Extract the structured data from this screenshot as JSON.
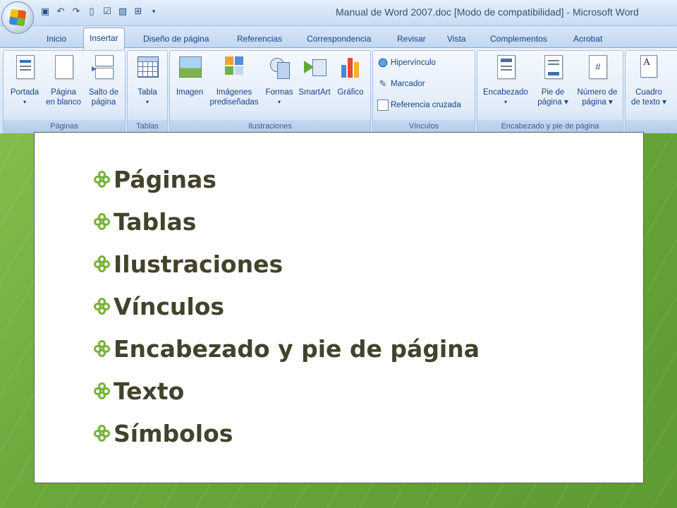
{
  "window": {
    "title": "Manual de Word 2007.doc [Modo de compatibilidad] - Microsoft Word"
  },
  "quick_access": [
    {
      "icon": "save-icon"
    },
    {
      "icon": "undo-icon"
    },
    {
      "icon": "redo-icon"
    },
    {
      "icon": "new-document-icon"
    },
    {
      "icon": "check-icon"
    },
    {
      "icon": "image-icon"
    },
    {
      "icon": "hierarchy-icon"
    },
    {
      "icon": "customize-arrow-icon"
    }
  ],
  "tabs": [
    {
      "label": "Inicio"
    },
    {
      "label": "Insertar",
      "active": true
    },
    {
      "label": "Diseño de página"
    },
    {
      "label": "Referencias"
    },
    {
      "label": "Correspondencia"
    },
    {
      "label": "Revisar"
    },
    {
      "label": "Vista"
    },
    {
      "label": "Complementos"
    },
    {
      "label": "Acrobat"
    }
  ],
  "ribbon": {
    "groups": [
      {
        "label": "Páginas",
        "buttons": [
          {
            "label1": "Portada",
            "label2": "▾"
          },
          {
            "label1": "Página",
            "label2": "en blanco"
          },
          {
            "label1": "Salto de",
            "label2": "página"
          }
        ]
      },
      {
        "label": "Tablas",
        "buttons": [
          {
            "label1": "Tabla",
            "label2": "▾"
          }
        ]
      },
      {
        "label": "Ilustraciones",
        "buttons": [
          {
            "label1": "Imagen",
            "label2": ""
          },
          {
            "label1": "Imágenes",
            "label2": "prediseñadas"
          },
          {
            "label1": "Formas",
            "label2": "▾"
          },
          {
            "label1": "SmartArt",
            "label2": ""
          },
          {
            "label1": "Gráfico",
            "label2": ""
          }
        ]
      },
      {
        "label": "Vínculos",
        "items": [
          {
            "label": "Hipervínculo"
          },
          {
            "label": "Marcador"
          },
          {
            "label": "Referencia cruzada"
          }
        ]
      },
      {
        "label": "Encabezado y pie de página",
        "buttons": [
          {
            "label1": "Encabezado",
            "label2": "▾"
          },
          {
            "label1": "Pie de",
            "label2": "página ▾"
          },
          {
            "label1": "Número de",
            "label2": "página ▾"
          }
        ]
      },
      {
        "label": "",
        "buttons": [
          {
            "label1": "Cuadro",
            "label2": "de texto ▾"
          }
        ]
      }
    ]
  },
  "slide": {
    "bullets": [
      "Páginas",
      "Tablas",
      "Ilustraciones",
      "Vínculos",
      "Encabezado y pie de página",
      "Texto",
      "Símbolos"
    ],
    "colors": {
      "bullet": "#77b33a",
      "text": "#43432c"
    }
  }
}
